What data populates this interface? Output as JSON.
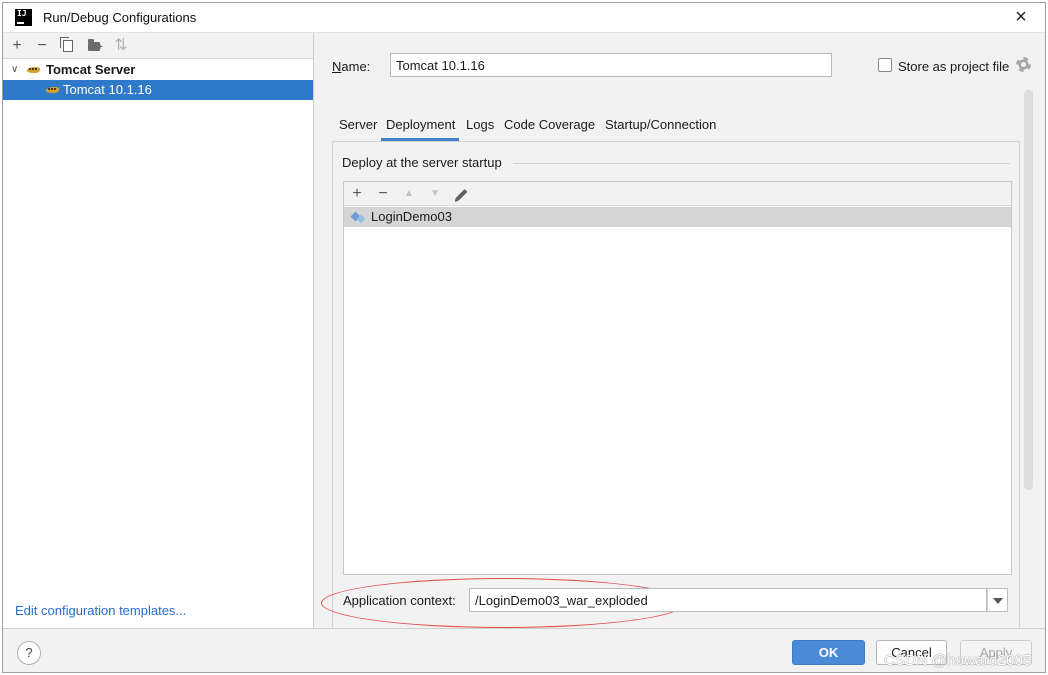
{
  "window": {
    "title": "Run/Debug Configurations",
    "app_icon_text": "IJ"
  },
  "left_toolbar": {
    "add": "+",
    "remove": "−",
    "sort": "⇅"
  },
  "tree": {
    "group_label": "Tomcat Server",
    "item_label": "Tomcat 10.1.16"
  },
  "left_footer": {
    "edit_templates": "Edit configuration templates..."
  },
  "config": {
    "name_label": "Name:",
    "name_value": "Tomcat 10.1.16",
    "store_label": "Store as project file",
    "store_checked": false
  },
  "tabs": [
    {
      "label": "Server",
      "active": false
    },
    {
      "label": "Deployment",
      "active": true
    },
    {
      "label": "Logs",
      "active": false
    },
    {
      "label": "Code Coverage",
      "active": false
    },
    {
      "label": "Startup/Connection",
      "active": false
    }
  ],
  "deployment": {
    "section_title": "Deploy at the server startup",
    "toolbar": {
      "add": "+",
      "remove": "−",
      "up": "▲",
      "down": "▼"
    },
    "artifacts": [
      "LoginDemo03"
    ],
    "context_label": "Application context:",
    "context_value": "/LoginDemo03_war_exploded"
  },
  "footer": {
    "help": "?",
    "ok": "OK",
    "cancel": "Cancel",
    "apply": "Apply",
    "watermark": "CSDN @howard2005"
  },
  "colors": {
    "selection": "#2f79c9",
    "accent": "#4083c9",
    "ok_button": "#4a8ad6",
    "link": "#2a6cc9",
    "annotation": "#e24a4a"
  }
}
